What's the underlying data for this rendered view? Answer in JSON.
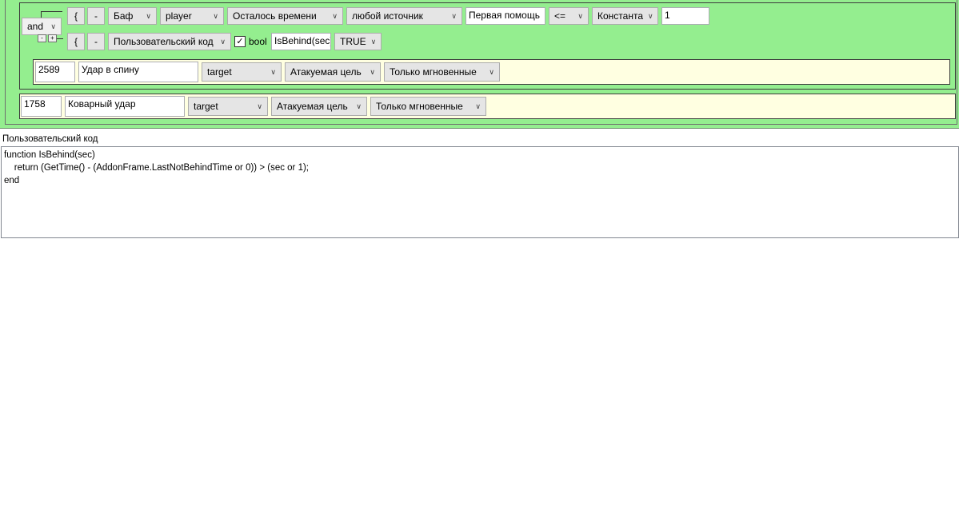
{
  "condition_block": {
    "logic_op": "and",
    "row1": {
      "brace": "{",
      "minus": "-",
      "type": "Баф",
      "unit": "player",
      "property": "Осталось времени",
      "source": "любой источник",
      "aura_name": "Первая помощь",
      "operator": "<=",
      "value_type": "Константа",
      "value": "1"
    },
    "row2": {
      "brace": "{",
      "minus": "-",
      "type": "Пользовательский код",
      "checked": "✓",
      "bool_label": "bool",
      "code_name": "IsBehind(sec)",
      "result": "TRUE"
    },
    "tree_minus": "-",
    "tree_plus": "+",
    "action": {
      "spell_id": "2589",
      "spell_name": "Удар в спину",
      "target": "target",
      "target_desc": "Атакуемая цель",
      "cast_mode": "Только мгновенные"
    }
  },
  "fallback_action": {
    "spell_id": "1758",
    "spell_name": "Коварный удар",
    "target": "target",
    "target_desc": "Атакуемая цель",
    "cast_mode": "Только мгновенные"
  },
  "code_panel": {
    "title": "Пользовательский код",
    "code": "function IsBehind(sec)\n    return (GetTime() - (AddonFrame.LastNotBehindTime or 0)) > (sec or 1);\nend"
  },
  "icons": {
    "dropdown": "chevron-down-icon",
    "checkbox": "checkmark-icon"
  }
}
